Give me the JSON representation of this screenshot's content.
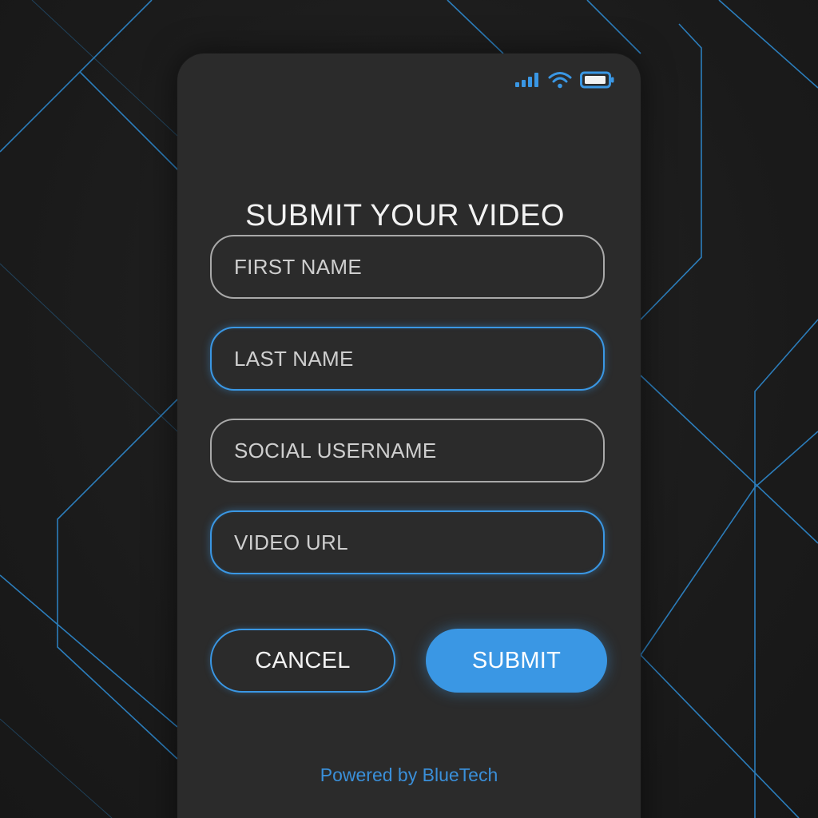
{
  "colors": {
    "accent": "#3a97e4",
    "panel": "#2b2b2b",
    "background": "#1c1c1c",
    "field_border": "#a9a9a9"
  },
  "status_bar": {
    "icons": [
      "signal-icon",
      "wifi-icon",
      "battery-icon"
    ]
  },
  "form": {
    "title": "SUBMIT YOUR VIDEO",
    "fields": [
      {
        "name": "first-name",
        "placeholder": "FIRST NAME",
        "value": ""
      },
      {
        "name": "last-name",
        "placeholder": "LAST NAME",
        "value": ""
      },
      {
        "name": "social-username",
        "placeholder": "SOCIAL USERNAME",
        "value": ""
      },
      {
        "name": "video-url",
        "placeholder": "VIDEO URL",
        "value": ""
      }
    ],
    "cancel_label": "CANCEL",
    "submit_label": "SUBMIT"
  },
  "footer": {
    "text": "Powered by BlueTech"
  }
}
